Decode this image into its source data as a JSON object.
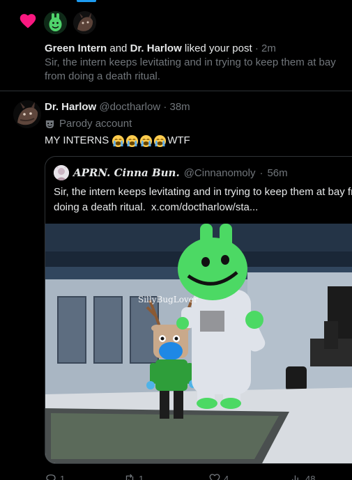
{
  "notification": {
    "actor_1": "Green Intern",
    "conjunction": "and",
    "actor_2": "Dr. Harlow",
    "action": "liked your post",
    "separator": "·",
    "time": "2m",
    "preview": "Sir, the intern keeps levitating and in trying to keep them at bay from doing a death ritual.",
    "icons": [
      "heart-icon"
    ]
  },
  "tweet": {
    "name": "Dr. Harlow",
    "handle": "@doctharlow",
    "separator": "·",
    "time": "38m",
    "label": "Parody account",
    "text": "MY INTERNS",
    "text_suffix": "WTF",
    "emoji": "loudly-crying-face"
  },
  "quote": {
    "name": "APRN. Cinna Bun.",
    "handle": "@Cinnanomoly",
    "separator": "·",
    "time": "56m",
    "text_line_1": "Sir, the intern keeps levitating and in trying to keep them at bay from",
    "text_line_2": "doing a death ritual.",
    "link": "x.com/doctharlow/sta...",
    "media_watermark": "SillyBugLover"
  },
  "actions": {
    "replies": "1",
    "reposts": "1",
    "likes": "4",
    "views": "48"
  },
  "colors": {
    "background": "#000000",
    "text": "#e7e9ea",
    "muted": "#71767b",
    "border": "#2f3336",
    "heart": "#f91880",
    "accent": "#1d9bf0"
  }
}
